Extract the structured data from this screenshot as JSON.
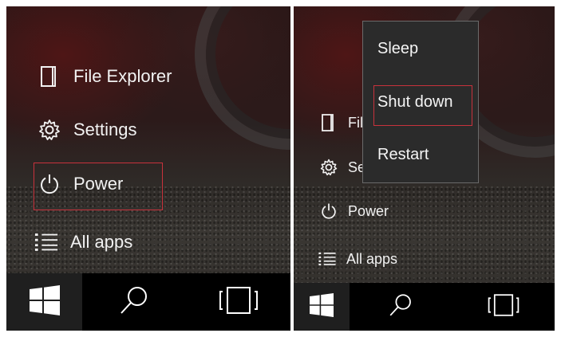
{
  "left_panel": {
    "menu": [
      {
        "label": "File Explorer",
        "icon": "file-explorer-icon"
      },
      {
        "label": "Settings",
        "icon": "gear-icon"
      },
      {
        "label": "Power",
        "icon": "power-icon"
      },
      {
        "label": "All apps",
        "icon": "list-icon"
      }
    ],
    "highlighted_item": "Power"
  },
  "right_panel": {
    "menu": [
      {
        "label": "Fil",
        "icon": "file-explorer-icon"
      },
      {
        "label": "Se",
        "icon": "gear-icon"
      },
      {
        "label": "Power",
        "icon": "power-icon"
      },
      {
        "label": "All apps",
        "icon": "list-icon"
      }
    ],
    "power_flyout": {
      "items": [
        {
          "label": "Sleep"
        },
        {
          "label": "Shut down"
        },
        {
          "label": "Restart"
        }
      ],
      "highlighted_item": "Shut down"
    }
  },
  "taskbar": {
    "buttons": [
      "windows-start-icon",
      "search-icon",
      "task-view-icon"
    ]
  },
  "colors": {
    "highlight_border": "#c8323c",
    "taskbar": "#000000",
    "flyout_bg": "#2b2b2b",
    "text": "#f2f2f2"
  }
}
